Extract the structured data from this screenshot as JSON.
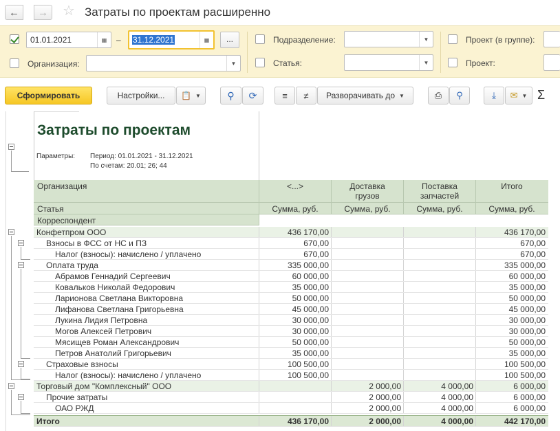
{
  "window": {
    "title": "Затраты по проектам расширенно"
  },
  "filters": {
    "date_from": "01.01.2021",
    "date_dash": "–",
    "date_to": "31.12.2021",
    "dots_label": "...",
    "organization_label": "Организация:",
    "organization_value": "",
    "division_label": "Подразделение:",
    "division_value": "",
    "item_label": "Статья:",
    "item_value": "",
    "project_group_label": "Проект (в группе):",
    "project_group_value": "",
    "project_label": "Проект:",
    "project_value": "",
    "period_checked": true
  },
  "toolbar": {
    "generate_label": "Сформировать",
    "settings_label": "Настройки...",
    "expand_label": "Разворачивать до",
    "sigma_label": "Σ"
  },
  "report": {
    "title": "Затраты по проектам",
    "params_label": "Параметры:",
    "params_period": "Период: 01.01.2021 - 31.12.2021",
    "params_accounts": "По счетам: 20.01; 26; 44",
    "header": {
      "organization": "Организация",
      "item": "Статья",
      "correspondent": "Корреспондент",
      "col1": "<...>",
      "col2_line1": "Доставка",
      "col2_line2": "грузов",
      "col3_line1": "Поставка",
      "col3_line2": "запчастей",
      "col4": "Итого",
      "amount": "Сумма, руб."
    },
    "rows": [
      {
        "label": "Конфетпром ООО",
        "level": 0,
        "c1": "436 170,00",
        "c2": "",
        "c3": "",
        "c4": "436 170,00"
      },
      {
        "label": "Взносы в ФСС от НС и ПЗ",
        "level": 1,
        "c1": "670,00",
        "c2": "",
        "c3": "",
        "c4": "670,00"
      },
      {
        "label": "Налог (взносы): начислено / уплачено",
        "level": 2,
        "c1": "670,00",
        "c2": "",
        "c3": "",
        "c4": "670,00"
      },
      {
        "label": "Оплата труда",
        "level": 1,
        "c1": "335 000,00",
        "c2": "",
        "c3": "",
        "c4": "335 000,00"
      },
      {
        "label": "Абрамов Геннадий Сергеевич",
        "level": 2,
        "c1": "60 000,00",
        "c2": "",
        "c3": "",
        "c4": "60 000,00"
      },
      {
        "label": "Ковальков Николай Федорович",
        "level": 2,
        "c1": "35 000,00",
        "c2": "",
        "c3": "",
        "c4": "35 000,00"
      },
      {
        "label": "Ларионова Светлана Викторовна",
        "level": 2,
        "c1": "50 000,00",
        "c2": "",
        "c3": "",
        "c4": "50 000,00"
      },
      {
        "label": "Лифанова Светлана Григорьевна",
        "level": 2,
        "c1": "45 000,00",
        "c2": "",
        "c3": "",
        "c4": "45 000,00"
      },
      {
        "label": "Лукина Лидия Петровна",
        "level": 2,
        "c1": "30 000,00",
        "c2": "",
        "c3": "",
        "c4": "30 000,00"
      },
      {
        "label": "Могов Алексей Петрович",
        "level": 2,
        "c1": "30 000,00",
        "c2": "",
        "c3": "",
        "c4": "30 000,00"
      },
      {
        "label": "Мясищев Роман Александрович",
        "level": 2,
        "c1": "50 000,00",
        "c2": "",
        "c3": "",
        "c4": "50 000,00"
      },
      {
        "label": "Петров Анатолий Григорьевич",
        "level": 2,
        "c1": "35 000,00",
        "c2": "",
        "c3": "",
        "c4": "35 000,00"
      },
      {
        "label": "Страховые взносы",
        "level": 1,
        "c1": "100 500,00",
        "c2": "",
        "c3": "",
        "c4": "100 500,00"
      },
      {
        "label": "Налог (взносы): начислено / уплачено",
        "level": 2,
        "c1": "100 500,00",
        "c2": "",
        "c3": "",
        "c4": "100 500,00"
      },
      {
        "label": "Торговый дом \"Комплексный\" ООО",
        "level": 0,
        "c1": "",
        "c2": "2 000,00",
        "c3": "4 000,00",
        "c4": "6 000,00"
      },
      {
        "label": "Прочие затраты",
        "level": 1,
        "c1": "",
        "c2": "2 000,00",
        "c3": "4 000,00",
        "c4": "6 000,00"
      },
      {
        "label": "ОАО РЖД",
        "level": 2,
        "c1": "",
        "c2": "2 000,00",
        "c3": "4 000,00",
        "c4": "6 000,00"
      }
    ],
    "total": {
      "label": "Итого",
      "c1": "436 170,00",
      "c2": "2 000,00",
      "c3": "4 000,00",
      "c4": "442 170,00"
    }
  }
}
